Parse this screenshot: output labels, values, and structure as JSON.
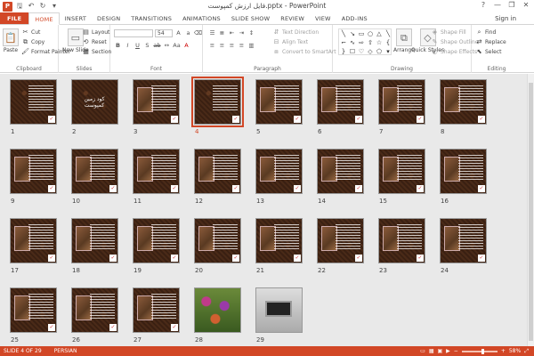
{
  "window": {
    "title": "فایل ارزش کمپوست.pptx - PowerPoint",
    "app_logo": "P",
    "signin": "Sign in",
    "controls": [
      "?",
      "—",
      "❐",
      "✕"
    ]
  },
  "qat": {
    "icons": [
      "save-icon",
      "undo-icon",
      "redo-icon",
      "customize-icon"
    ]
  },
  "tabs": [
    "FILE",
    "HOME",
    "INSERT",
    "DESIGN",
    "TRANSITIONS",
    "ANIMATIONS",
    "SLIDE SHOW",
    "REVIEW",
    "VIEW",
    "ADD-INS"
  ],
  "active_tab": "HOME",
  "ribbon": {
    "clipboard": {
      "label": "Clipboard",
      "paste": "Paste",
      "cut": "Cut",
      "copy": "Copy",
      "format_painter": "Format Painter"
    },
    "slides": {
      "label": "Slides",
      "new_slide": "New Slide",
      "layout": "Layout",
      "reset": "Reset",
      "section": "Section"
    },
    "font": {
      "label": "Font",
      "font_name": "",
      "font_size": "54"
    },
    "paragraph": {
      "label": "Paragraph",
      "text_direction": "Text Direction",
      "align_text": "Align Text",
      "convert_smartart": "Convert to SmartArt"
    },
    "drawing": {
      "label": "Drawing",
      "arrange": "Arrange",
      "quick_styles": "Quick Styles",
      "shape_fill": "Shape Fill",
      "shape_outline": "Shape Outline",
      "shape_effects": "Shape Effects"
    },
    "editing": {
      "label": "Editing",
      "find": "Find",
      "replace": "Replace",
      "select": "Select"
    }
  },
  "slides": {
    "count": 29,
    "selected": 4,
    "items": [
      {
        "num": "1"
      },
      {
        "num": "2",
        "title": "کود زمین کمپوست"
      },
      {
        "num": "3"
      },
      {
        "num": "4"
      },
      {
        "num": "5"
      },
      {
        "num": "6"
      },
      {
        "num": "7"
      },
      {
        "num": "8"
      },
      {
        "num": "9"
      },
      {
        "num": "10"
      },
      {
        "num": "11"
      },
      {
        "num": "12"
      },
      {
        "num": "13"
      },
      {
        "num": "14"
      },
      {
        "num": "15"
      },
      {
        "num": "16"
      },
      {
        "num": "17"
      },
      {
        "num": "18"
      },
      {
        "num": "19"
      },
      {
        "num": "20"
      },
      {
        "num": "21"
      },
      {
        "num": "22"
      },
      {
        "num": "23"
      },
      {
        "num": "24"
      },
      {
        "num": "25"
      },
      {
        "num": "26"
      },
      {
        "num": "27"
      },
      {
        "num": "28"
      },
      {
        "num": "29"
      }
    ]
  },
  "status": {
    "slide_info": "SLIDE 4 OF 29",
    "language": "PERSIAN",
    "zoom": "58%"
  },
  "colors": {
    "accent": "#d24726"
  }
}
